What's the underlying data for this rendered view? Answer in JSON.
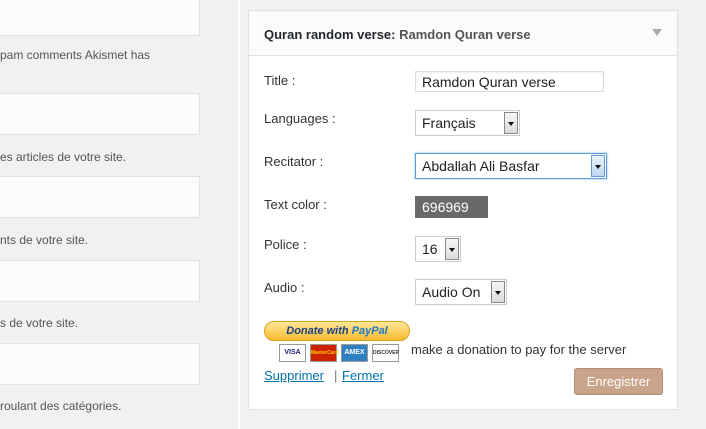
{
  "left_panel": {
    "descriptions": [
      "pam comments Akismet has",
      "es articles de votre site.",
      "nts de votre site.",
      "s de votre site.",
      "roulant des catégories."
    ]
  },
  "widget": {
    "title": "Quran random verse:",
    "instance_title": "Ramdon Quran verse",
    "fields": {
      "title_label": "Title :",
      "title_value": "Ramdon Quran verse",
      "languages_label": "Languages :",
      "languages_value": "Français",
      "reciter_label": "Recitator :",
      "reciter_value": "Abdallah Ali Basfar",
      "text_color_label": "Text color :",
      "text_color_value": "696969",
      "police_label": "Police :",
      "police_value": "16",
      "audio_label": "Audio :",
      "audio_value": "Audio On"
    },
    "donate": {
      "button_text": "Donate with",
      "button_brand": "PayPal",
      "cards": [
        "VISA",
        "MasterCard",
        "AMEX",
        "DISCOVER"
      ],
      "message": "make a donation to pay for the server"
    },
    "actions": {
      "delete_label": "Supprimer",
      "separator": "|",
      "close_label": "Fermer",
      "save_label": "Enregistrer"
    }
  },
  "colors": {
    "text_color_swatch": "#696969",
    "link": "#0073aa",
    "save_button": "#c9a48a"
  }
}
